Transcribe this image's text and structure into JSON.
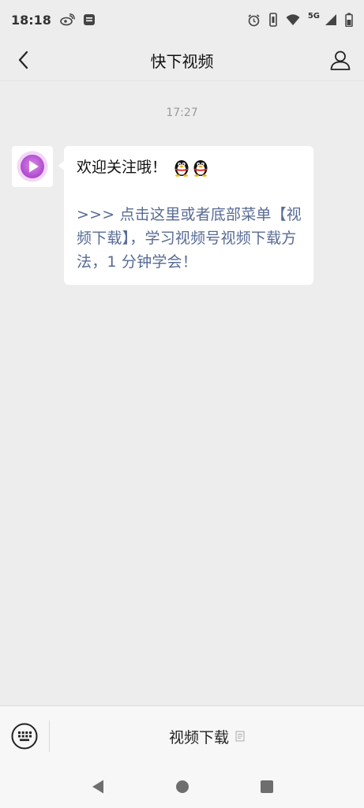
{
  "status_bar": {
    "time": "18:18",
    "network": "5G"
  },
  "nav": {
    "title": "快下视频"
  },
  "chat": {
    "timestamp": "17:27",
    "message": {
      "greeting": "欢迎关注哦！",
      "emoji_icons": [
        "qq-penguin-icon",
        "qq-penguin-icon"
      ],
      "link_text": ">>> 点击这里或者底部菜单【视频下载】，学习视频号视频下载方法，1 分钟学会！"
    }
  },
  "bottom_menu": {
    "item_label": "视频下载"
  },
  "colors": {
    "background": "#ededed",
    "link": "#576b95",
    "avatar_purple": "#b44fd6"
  }
}
